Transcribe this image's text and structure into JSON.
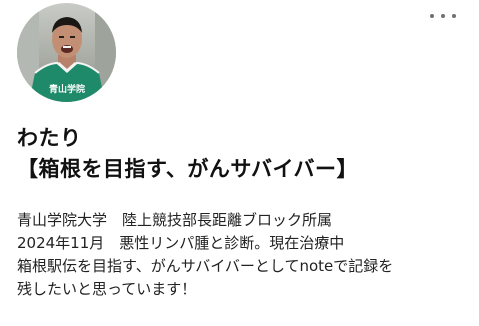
{
  "profile": {
    "avatar": {
      "icon": "runner-photo",
      "jersey_text": "青山学院"
    },
    "name": "わたり",
    "tagline": "【箱根を目指す、がんサバイバー】",
    "bio_lines": [
      "青山学院大学　陸上競技部長距離ブロック所属",
      "2024年11月　悪性リンパ腫と診断。現在治療中",
      "箱根駅伝を目指す、がんサバイバーとしてnoteで記録を",
      "残したいと思っています！"
    ]
  },
  "menu": {
    "icon": "more-horizontal-icon"
  },
  "colors": {
    "jersey_green": "#1f8a6a",
    "text": "#222222",
    "icon_gray": "#707070"
  }
}
